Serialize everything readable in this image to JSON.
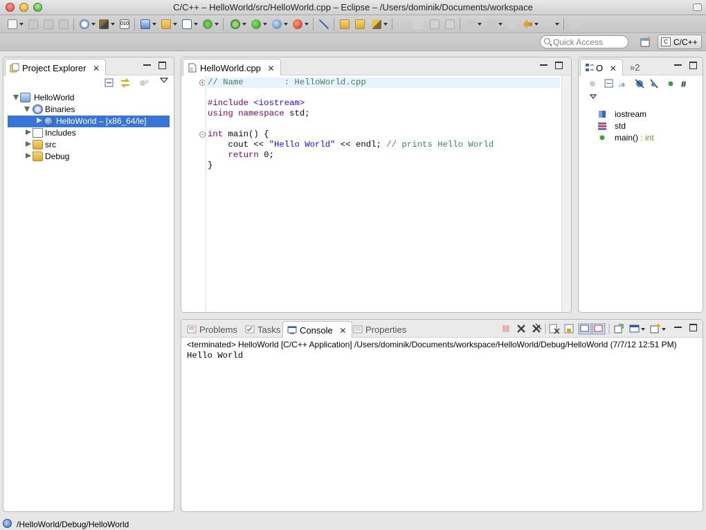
{
  "window": {
    "title": "C/C++ – HelloWorld/src/HelloWorld.cpp – Eclipse – /Users/dominik/Documents/workspace"
  },
  "perspective_bar": {
    "quick_access_placeholder": "Quick Access",
    "active_perspective": "C/C++"
  },
  "project_explorer": {
    "tab_label": "Project Explorer",
    "tree": [
      {
        "label": "HelloWorld",
        "icon": "project-icon",
        "expanded": true
      },
      {
        "label": "Binaries",
        "icon": "binaries-icon",
        "expanded": true
      },
      {
        "label": "HelloWorld – [x86_64/le]",
        "icon": "executable-icon",
        "selected": true
      },
      {
        "label": "Includes",
        "icon": "includes-icon",
        "expanded": false
      },
      {
        "label": "src",
        "icon": "folder-icon",
        "expanded": false
      },
      {
        "label": "Debug",
        "icon": "folder-icon",
        "expanded": false
      }
    ]
  },
  "editor": {
    "tab_label": "HelloWorld.cpp",
    "lines": {
      "l1_comment": "// Name        : HelloWorld.cpp",
      "l3_include_kw": "#include",
      "l3_include_file": " <iostream>",
      "l4_using": "using",
      "l4_namespace": "namespace",
      "l4_rest": " std;",
      "l6_int": "int",
      "l6_rest": " main() {",
      "l7_indent": "    cout << ",
      "l7_string": "\"Hello World\"",
      "l7_mid": " << endl; ",
      "l7_comment": "// prints Hello World",
      "l8_indent": "    ",
      "l8_return": "return",
      "l8_rest": " 0;",
      "l9": "}"
    }
  },
  "outline": {
    "tab_label": "O",
    "overflow_label": "»2",
    "items": [
      {
        "label": "iostream",
        "icon": "include-icon"
      },
      {
        "label": "std",
        "icon": "namespace-icon"
      },
      {
        "label": "main()",
        "type": " : int",
        "icon": "function-icon"
      }
    ]
  },
  "bottom_panel": {
    "tabs": {
      "problems": "Problems",
      "tasks": "Tasks",
      "console": "Console",
      "properties": "Properties"
    },
    "console_header": "<terminated> HelloWorld [C/C++ Application] /Users/dominik/Documents/workspace/HelloWorld/Debug/HelloWorld (7/7/12 12:51 PM)",
    "console_output": "Hello World"
  },
  "status_bar": {
    "text": "/HelloWorld/Debug/HelloWorld"
  },
  "colors": {
    "selection": "#3875d7",
    "keyword": "#7f0055",
    "comment": "#3f7f5f",
    "string": "#2a00ff"
  }
}
